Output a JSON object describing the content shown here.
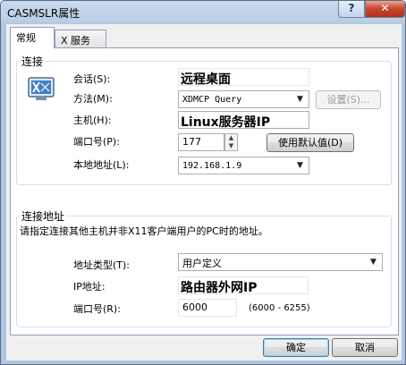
{
  "window": {
    "title": "CASMSLR属性",
    "help_label": "?",
    "close_label": "✕"
  },
  "tabs": [
    {
      "label": "常规",
      "active": true
    },
    {
      "label": "X 服务器",
      "active": false
    }
  ],
  "connection": {
    "group_label": "连接",
    "session_label": "会话(S):",
    "session_value": "远程桌面",
    "method_label": "方法(M):",
    "method_value": "XDMCP Query",
    "settings_button": "设置(S)...",
    "host_label": "主机(H):",
    "host_value": "Linux服务器IP",
    "port_label": "端口号(P):",
    "port_value": "177",
    "default_button": "使用默认值(D)",
    "local_addr_label": "本地地址(L):",
    "local_addr_value": "192.168.1.9"
  },
  "conn_addr": {
    "group_label": "连接地址",
    "description": "请指定连接其他主机并非X11客户端用户的PC时的地址。",
    "addr_type_label": "地址类型(T):",
    "addr_type_value": "用户定义",
    "ip_label": "IP地址:",
    "ip_value": "路由器外网IP",
    "port_label": "端口号(R):",
    "port_value": "6000",
    "port_range": "(6000 - 6255)"
  },
  "footer": {
    "ok_button": "确定",
    "cancel_button": "取消"
  },
  "icons": {
    "app": "xwindow-app-icon",
    "dropdown": "chevron-down-icon",
    "spin_up": "arrow-up-icon",
    "spin_down": "arrow-down-icon"
  }
}
